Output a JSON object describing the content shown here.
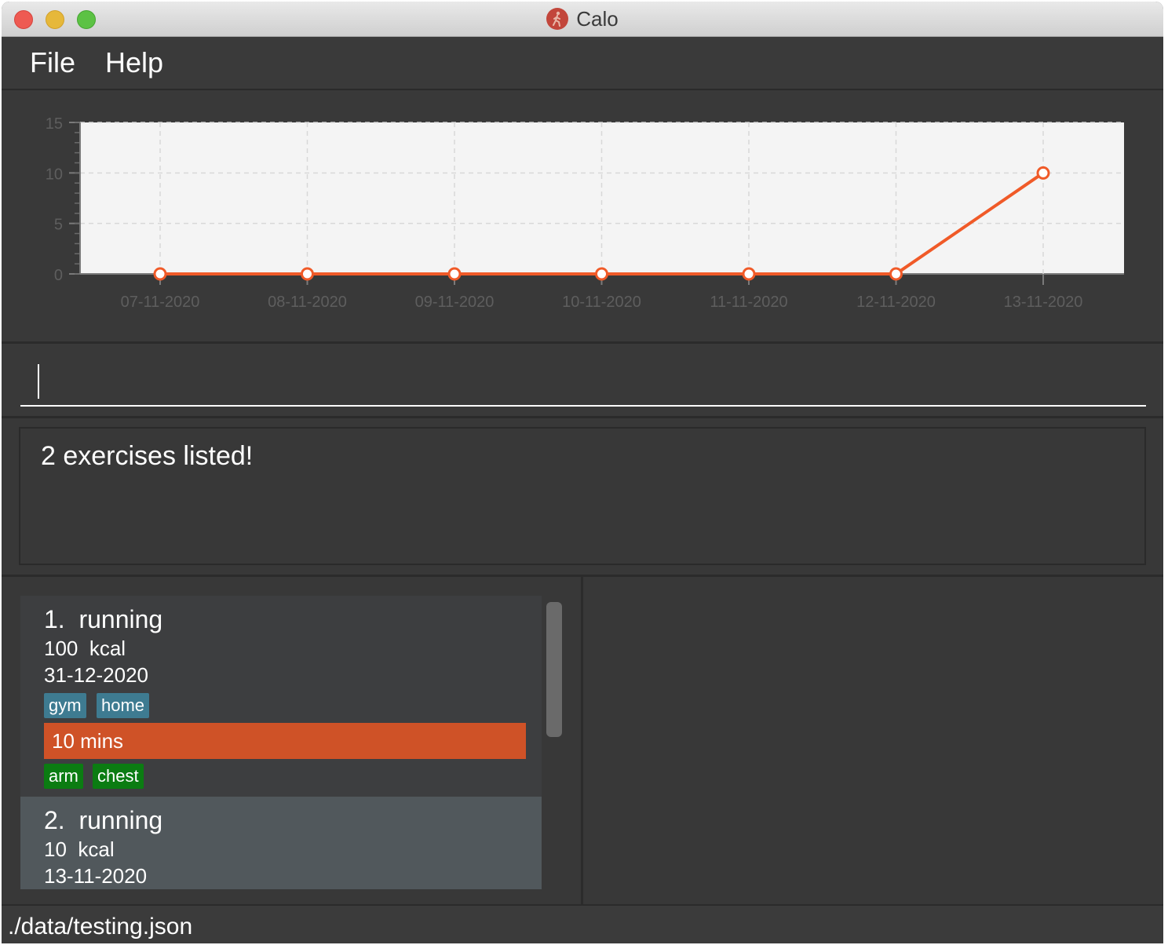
{
  "window": {
    "title": "Calo",
    "app_icon": "runner-icon"
  },
  "menu": {
    "file": "File",
    "help": "Help"
  },
  "chart_data": {
    "type": "line",
    "x": [
      "07-11-2020",
      "08-11-2020",
      "09-11-2020",
      "10-11-2020",
      "11-11-2020",
      "12-11-2020",
      "13-11-2020"
    ],
    "series": [
      {
        "values": [
          0,
          0,
          0,
          0,
          0,
          0,
          10
        ],
        "color": "#f05a28"
      }
    ],
    "yticks": [
      0,
      5,
      10,
      15
    ],
    "ylim": [
      0,
      15
    ],
    "grid": true,
    "title": "",
    "xlabel": "",
    "ylabel": ""
  },
  "command": {
    "value": "",
    "placeholder": ""
  },
  "result": {
    "text": "2 exercises listed!"
  },
  "exercises": [
    {
      "index": "1.",
      "name": "running",
      "calories": "100",
      "calories_unit": "kcal",
      "date": "31-12-2020",
      "tags": [
        "gym",
        "home"
      ],
      "duration": "10 mins",
      "muscles": [
        "arm",
        "chest"
      ]
    },
    {
      "index": "2.",
      "name": "running",
      "calories": "10",
      "calories_unit": "kcal",
      "date": "13-11-2020"
    }
  ],
  "status": {
    "file_path": "./data/testing.json"
  },
  "colors": {
    "tag_blue": "#3e7b91",
    "tag_green": "#0b7c12",
    "duration": "#cf5227",
    "line": "#f05a28"
  }
}
